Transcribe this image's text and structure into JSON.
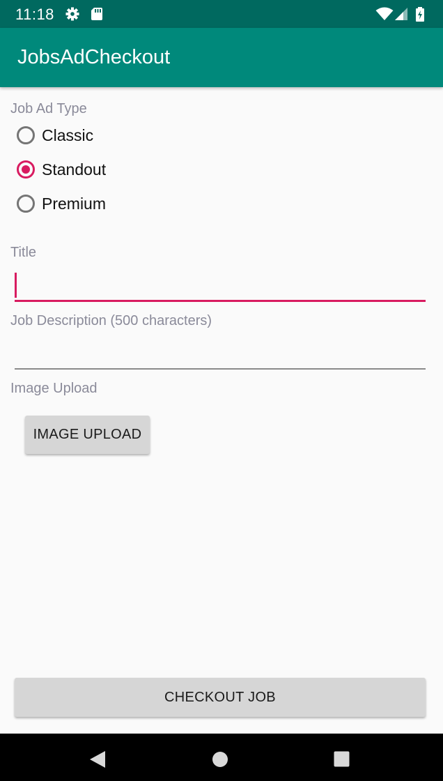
{
  "status_bar": {
    "time": "11:18",
    "icons": [
      "settings-icon",
      "sd-card-icon",
      "wifi-icon",
      "signal-icon",
      "battery-icon"
    ],
    "color": "#00695f"
  },
  "app_bar": {
    "title": "JobsAdCheckout",
    "color": "#00897b"
  },
  "job_ad_type": {
    "label": "Job Ad Type",
    "options": [
      {
        "label": "Classic",
        "checked": false
      },
      {
        "label": "Standout",
        "checked": true
      },
      {
        "label": "Premium",
        "checked": false
      }
    ],
    "accent": "#d81b60"
  },
  "title_field": {
    "label": "Title",
    "value": ""
  },
  "description_field": {
    "label": "Job Description (500 characters)",
    "value": ""
  },
  "image_upload": {
    "label": "Image Upload",
    "button_label": "IMAGE UPLOAD"
  },
  "checkout": {
    "button_label": "CHECKOUT JOB"
  },
  "nav_bar": {
    "icons": [
      "back-icon",
      "home-icon",
      "recents-icon"
    ]
  }
}
